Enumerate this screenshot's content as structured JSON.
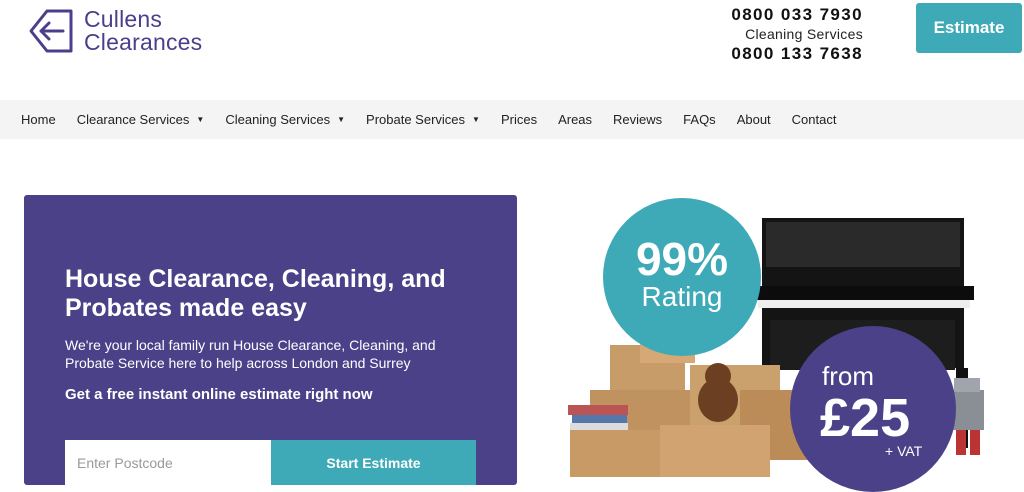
{
  "brand": {
    "line1": "Cullens",
    "line2": "Clearances",
    "color": "#4a3f8a",
    "icon": "arrow-left-icon"
  },
  "header": {
    "phone_primary": "0800 033 7930",
    "phone_secondary_label": "Cleaning Services",
    "phone_secondary": "0800 133 7638",
    "estimate_label": "Estimate"
  },
  "nav": {
    "items": [
      {
        "label": "Home"
      },
      {
        "label": "Clearance Services"
      },
      {
        "label": "Cleaning Services"
      },
      {
        "label": "Probate Services"
      },
      {
        "label": "Prices"
      },
      {
        "label": "Areas"
      },
      {
        "label": "Reviews"
      },
      {
        "label": "FAQs"
      },
      {
        "label": "About"
      },
      {
        "label": "Contact"
      }
    ],
    "caret": "▼"
  },
  "hero": {
    "title": "House Clearance, Cleaning, and Probates made easy",
    "description": "We're your local family run House Clearance, Cleaning, and Probate Service here to help across London and Surrey",
    "cta": "Get a free instant online estimate right now",
    "postcode_placeholder": "Enter Postcode",
    "start_label": "Start Estimate"
  },
  "badges": {
    "rating_pct": "99%",
    "rating_word": "Rating",
    "price_from": "from",
    "price_amount": "£25",
    "price_vat": "+ VAT"
  },
  "colors": {
    "accent": "#3eaab7",
    "purple": "#4a4189"
  }
}
